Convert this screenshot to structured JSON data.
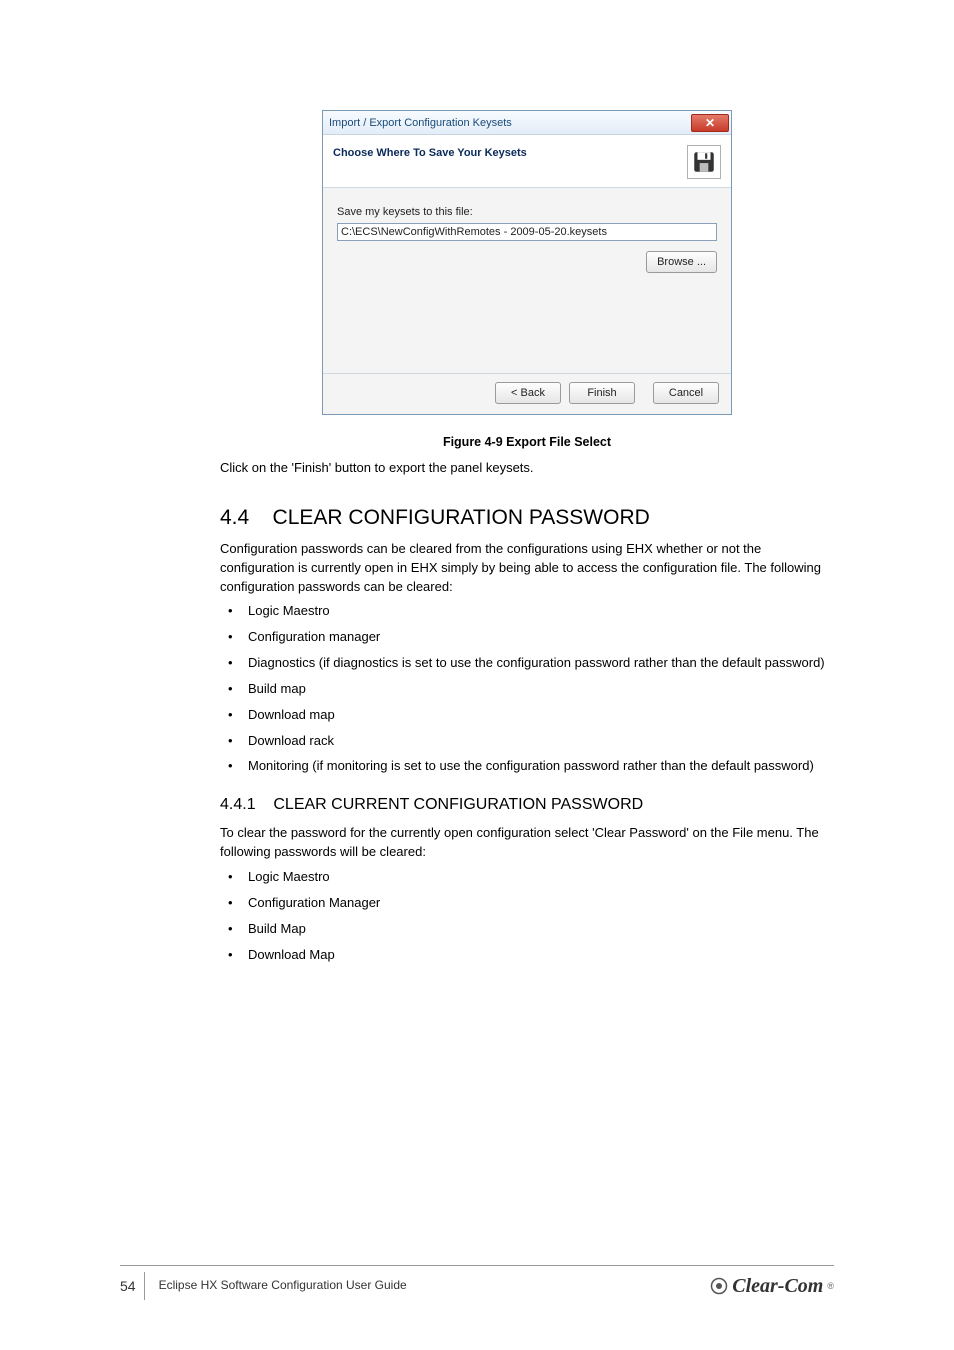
{
  "dialog": {
    "title": "Import / Export Configuration Keysets",
    "header": "Choose Where To Save Your Keysets",
    "label": "Save my keysets to this file:",
    "path": "C:\\ECS\\NewConfigWithRemotes - 2009-05-20.keysets",
    "browse": "Browse ...",
    "back": "< Back",
    "finish": "Finish",
    "cancel": "Cancel"
  },
  "caption": "Figure 4-9 Export File Select",
  "para_after_caption": "Click on the 'Finish' button to export the panel keysets.",
  "section_num": "4.4",
  "section_title": "CLEAR CONFIGURATION PASSWORD",
  "section_para": "Configuration passwords can be cleared from the configurations using EHX whether or not the configuration is currently open in EHX simply by being able to access the configuration file. The following configuration passwords can be cleared:",
  "bullets1": [
    "Logic Maestro",
    "Configuration manager",
    "Diagnostics (if diagnostics is set to use the configuration password rather than the default password)",
    "Build map",
    "Download map",
    "Download rack",
    "Monitoring (if monitoring is set to use the configuration password rather than the default password)"
  ],
  "sub_num": "4.4.1",
  "sub_title": "CLEAR CURRENT CONFIGURATION PASSWORD",
  "sub_para": "To clear the password for the currently open configuration select 'Clear Password' on the File menu. The following passwords will be cleared:",
  "bullets2": [
    "Logic Maestro",
    "Configuration Manager",
    "Build Map",
    "Download Map"
  ],
  "footer": {
    "page": "54",
    "doc": "Eclipse HX Software Configuration User Guide"
  },
  "logo": "Clear-Com"
}
